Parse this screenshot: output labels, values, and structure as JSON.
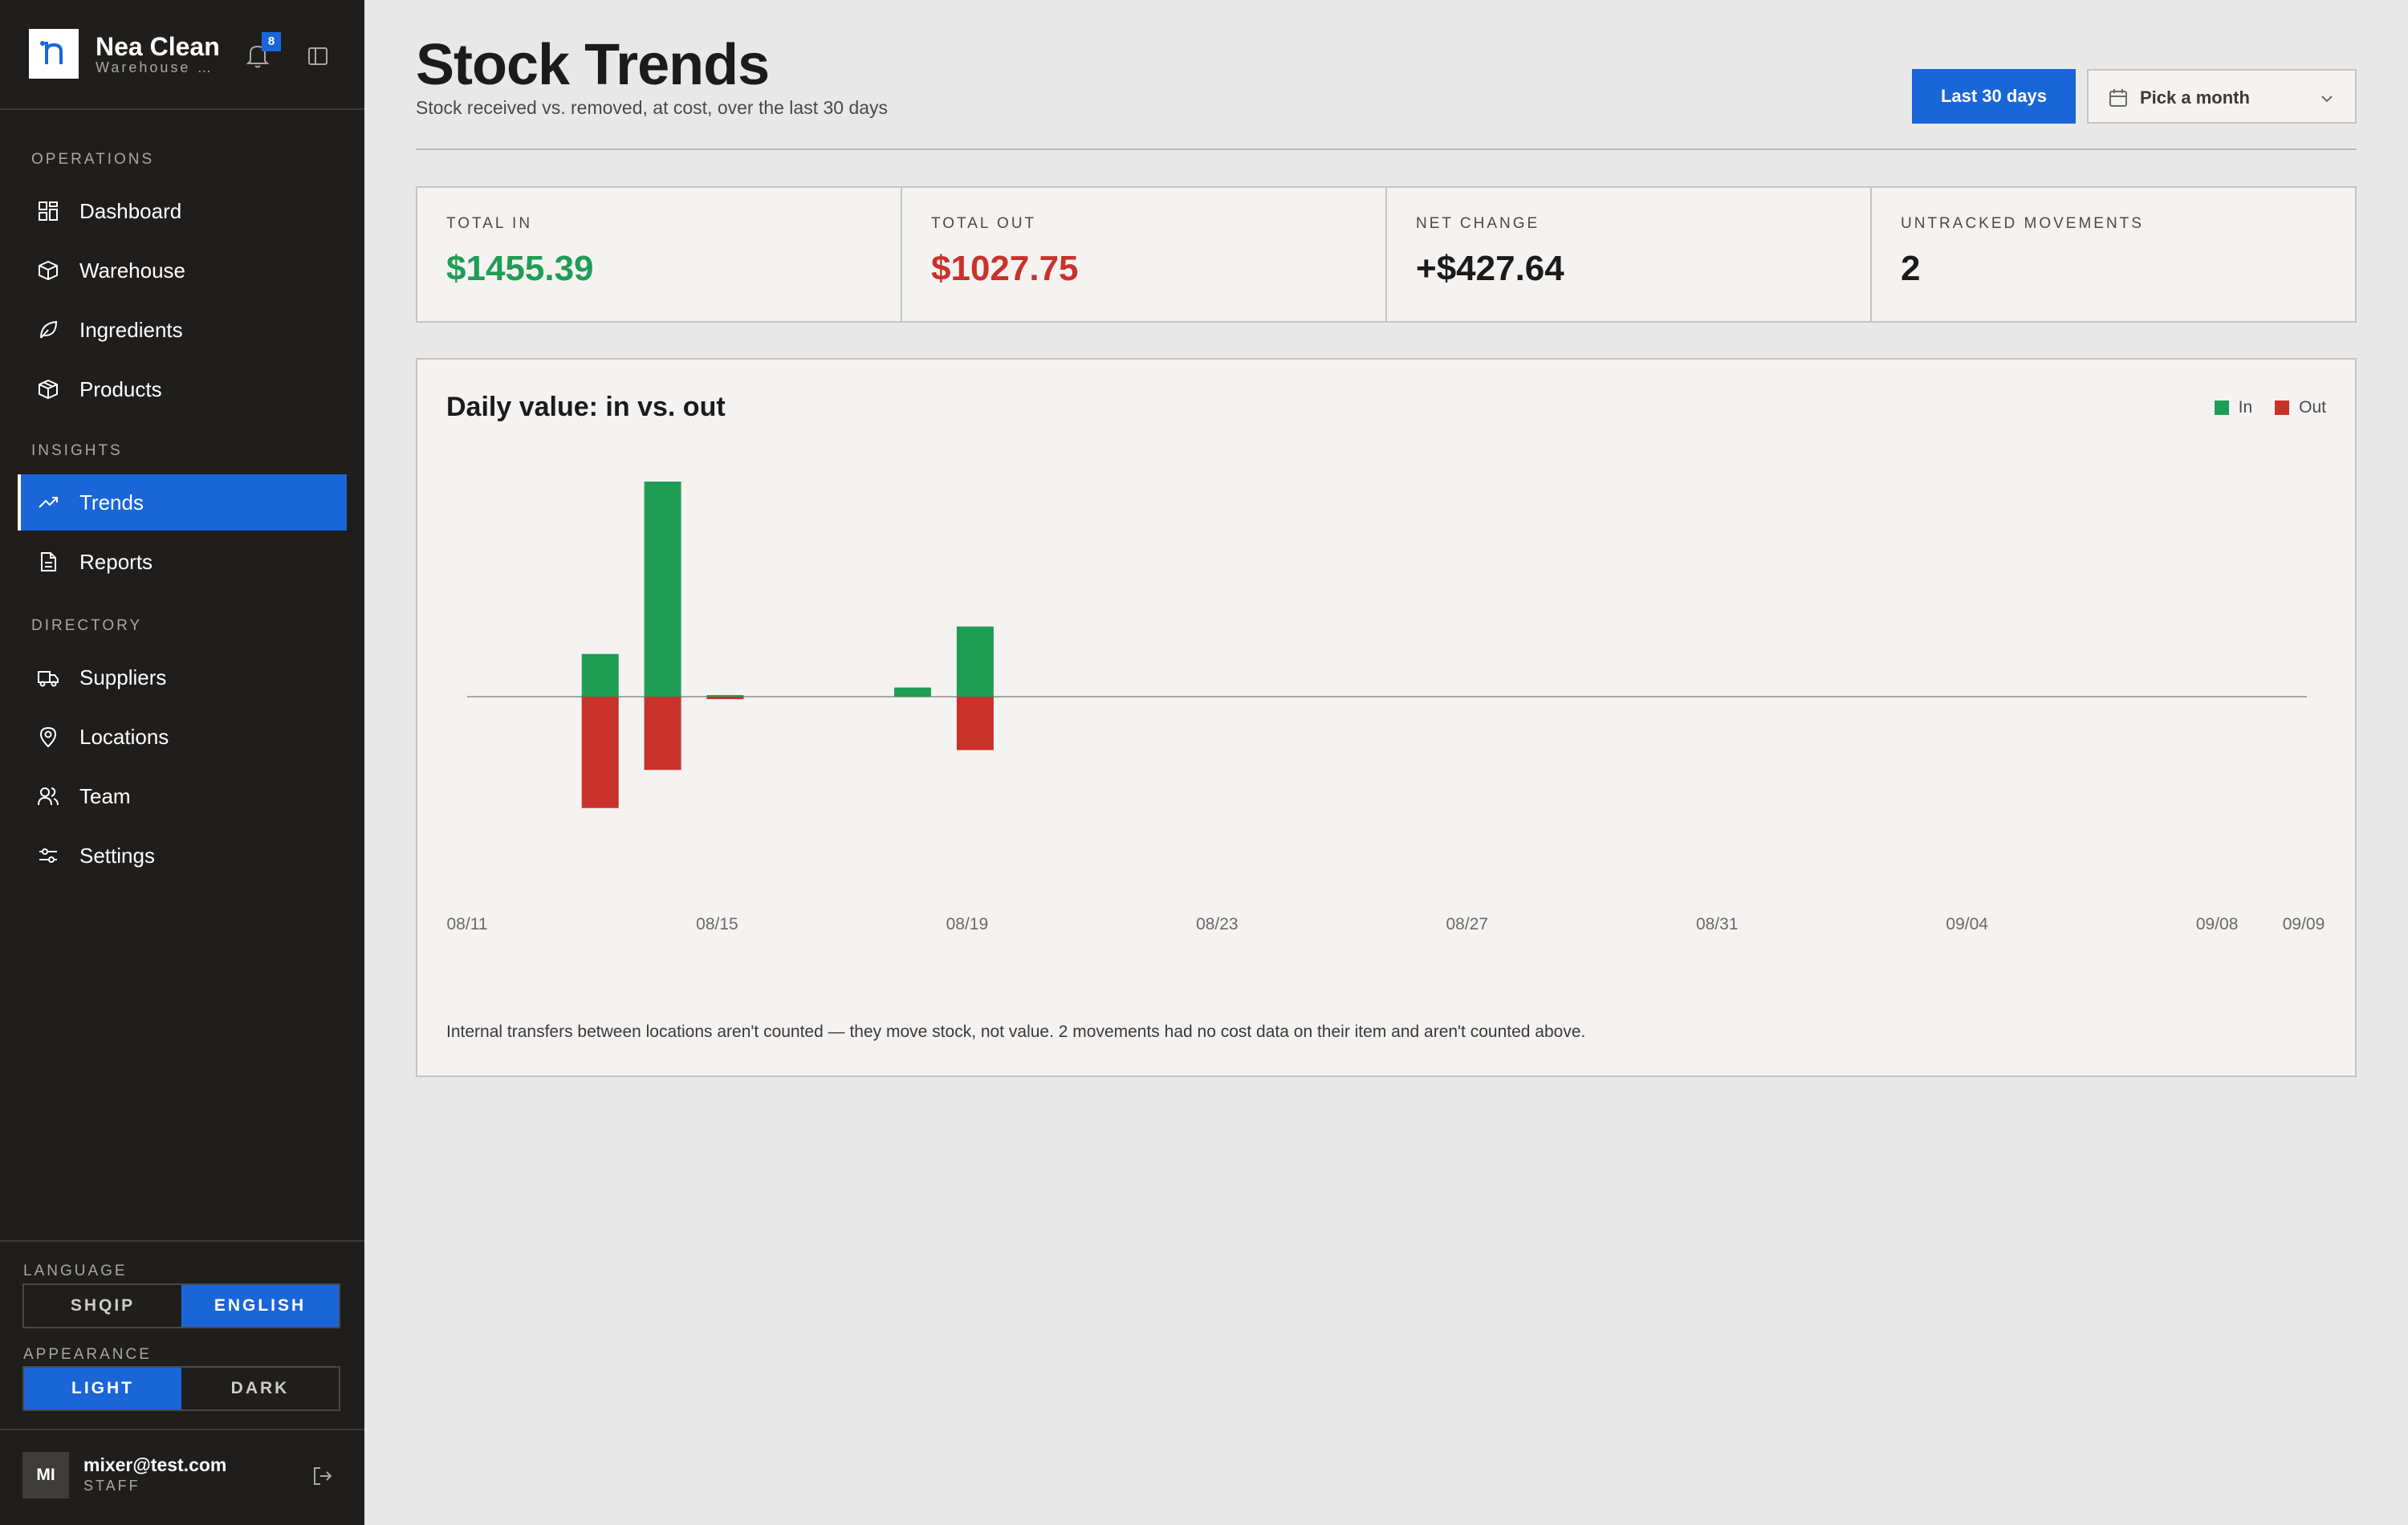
{
  "brand": {
    "name": "Nea Clean",
    "subtitle": "Warehouse management",
    "notifications": "8"
  },
  "nav": {
    "operations_label": "OPERATIONS",
    "insights_label": "INSIGHTS",
    "directory_label": "DIRECTORY",
    "items": [
      {
        "label": "Dashboard",
        "icon": "dashboard-icon"
      },
      {
        "label": "Warehouse",
        "icon": "box-icon"
      },
      {
        "label": "Ingredients",
        "icon": "leaf-icon"
      },
      {
        "label": "Products",
        "icon": "package-icon"
      },
      {
        "label": "Trends",
        "icon": "trend-icon",
        "active": true
      },
      {
        "label": "Reports",
        "icon": "document-icon"
      },
      {
        "label": "Suppliers",
        "icon": "truck-icon"
      },
      {
        "label": "Locations",
        "icon": "map-pin-icon"
      },
      {
        "label": "Team",
        "icon": "users-icon"
      },
      {
        "label": "Settings",
        "icon": "sliders-icon"
      }
    ]
  },
  "prefs": {
    "language_label": "LANGUAGE",
    "languages": [
      "SHQIP",
      "ENGLISH"
    ],
    "language_selected": "ENGLISH",
    "appearance_label": "APPEARANCE",
    "appearances": [
      "LIGHT",
      "DARK"
    ],
    "appearance_selected": "LIGHT"
  },
  "user": {
    "initials": "MI",
    "email": "mixer@test.com",
    "role": "STAFF"
  },
  "header": {
    "title": "Stock Trends",
    "subtitle": "Stock received vs. removed, at cost, over the last 30 days",
    "range_button": "Last 30 days",
    "month_placeholder": "Pick a month"
  },
  "stats": [
    {
      "label": "TOTAL IN",
      "value": "$1455.39",
      "color": "#1f9d55"
    },
    {
      "label": "TOTAL OUT",
      "value": "$1027.75",
      "color": "#c8322b"
    },
    {
      "label": "NET CHANGE",
      "value": "+$427.64",
      "color": "#1b1b1b"
    },
    {
      "label": "UNTRACKED MOVEMENTS",
      "value": "2",
      "color": "#1b1b1b"
    }
  ],
  "colors": {
    "in": "#1f9d55",
    "out": "#c8322b",
    "accent": "#1a66d9"
  },
  "chart_data": {
    "type": "bar",
    "title": "Daily value: in vs. out",
    "x_tick_labels": [
      "08/11",
      "08/15",
      "08/19",
      "08/23",
      "08/27",
      "08/31",
      "09/04",
      "09/08",
      "09/09"
    ],
    "series": [
      {
        "name": "In",
        "color": "#1f9d55",
        "points": [
          {
            "x": "08/13",
            "y": 140
          },
          {
            "x": "08/14",
            "y": 705
          },
          {
            "x": "08/15",
            "y": 2
          },
          {
            "x": "08/18",
            "y": 30
          },
          {
            "x": "08/19",
            "y": 230
          }
        ]
      },
      {
        "name": "Out",
        "color": "#c8322b",
        "points": [
          {
            "x": "08/13",
            "y": 365
          },
          {
            "x": "08/14",
            "y": 240
          },
          {
            "x": "08/15",
            "y": 8
          },
          {
            "x": "08/19",
            "y": 175
          }
        ]
      }
    ],
    "ylim": [
      -705,
      705
    ],
    "note": "Internal transfers between locations aren't counted — they move stock, not value. 2 movements had no cost data on their item and aren't counted above."
  }
}
